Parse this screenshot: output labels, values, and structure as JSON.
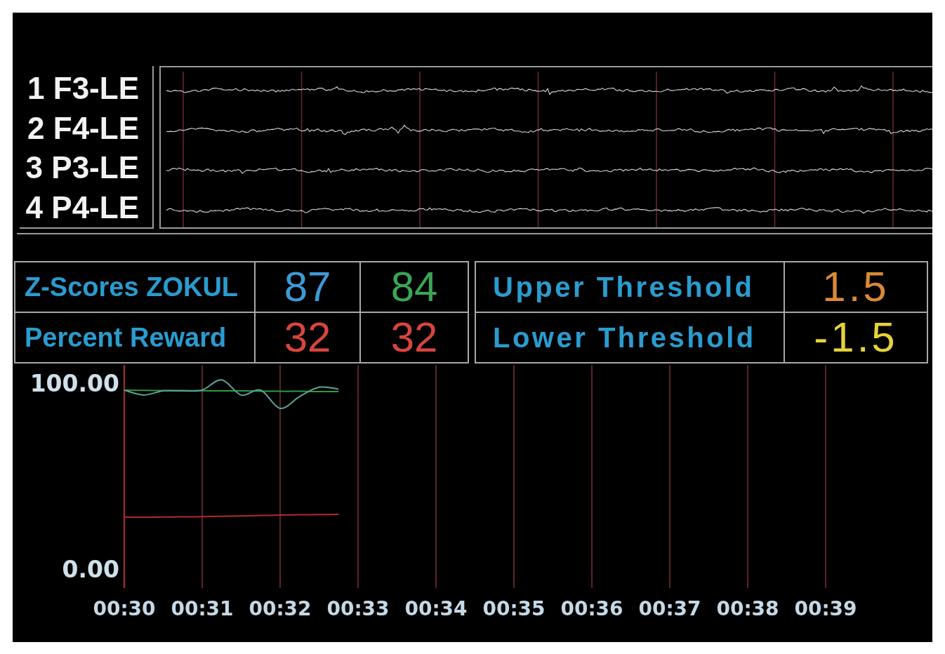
{
  "eeg": {
    "channels": [
      {
        "label": "1 F3-LE"
      },
      {
        "label": "2 F4-LE"
      },
      {
        "label": "3 P3-LE"
      },
      {
        "label": "4 P4-LE"
      }
    ]
  },
  "scores": {
    "rows": [
      {
        "label": "Z-Scores ZOKUL",
        "values": [
          {
            "text": "87",
            "color": "#3d9ad6"
          },
          {
            "text": "84",
            "color": "#3aa656"
          }
        ]
      },
      {
        "label": "Percent Reward",
        "values": [
          {
            "text": "32",
            "color": "#d8453e"
          },
          {
            "text": "32",
            "color": "#d8453e"
          }
        ]
      }
    ]
  },
  "thresholds": {
    "rows": [
      {
        "label": "Upper Threshold",
        "value": {
          "text": "1.5",
          "color": "#d98a35"
        }
      },
      {
        "label": "Lower Threshold",
        "value": {
          "text": "-1.5",
          "color": "#e5d23c"
        }
      }
    ]
  },
  "trend_chart": {
    "chart_data": {
      "type": "line",
      "grid": true,
      "x": [
        30.0,
        30.25,
        30.5,
        30.75,
        31.0,
        31.25,
        31.5,
        31.75,
        32.0,
        32.25,
        32.5,
        32.75
      ],
      "series": [
        {
          "color": "#2f9a3a",
          "values": [
            96.4,
            96.3,
            96.2,
            96.2,
            96.1,
            96,
            96,
            95.9,
            95.8,
            95.8,
            95.7,
            95.7
          ]
        },
        {
          "color": "#5aa39c",
          "values": [
            96.4,
            93.8,
            96,
            96,
            96.5,
            102,
            93.8,
            96.4,
            86.6,
            93,
            98,
            97
          ]
        },
        {
          "color": "#b32a2a",
          "values": [
            28.1,
            28.1,
            28.2,
            28.3,
            28.4,
            28.6,
            28.8,
            29,
            29.2,
            29.4,
            29.5,
            29.6
          ]
        }
      ],
      "xlim": [
        30,
        39
      ],
      "ylim": [
        -10,
        110
      ],
      "xticks": [
        {
          "value": 30,
          "label": "00:30"
        },
        {
          "value": 31,
          "label": "00:31"
        },
        {
          "value": 32,
          "label": "00:32"
        },
        {
          "value": 33,
          "label": "00:33"
        },
        {
          "value": 34,
          "label": "00:34"
        },
        {
          "value": 35,
          "label": "00:35"
        },
        {
          "value": 36,
          "label": "00:36"
        },
        {
          "value": 37,
          "label": "00:37"
        },
        {
          "value": 38,
          "label": "00:38"
        },
        {
          "value": 39,
          "label": "00:39"
        }
      ],
      "yticks": [
        {
          "value": 100,
          "label": "100.00"
        },
        {
          "value": 0,
          "label": "0.00"
        }
      ]
    }
  }
}
